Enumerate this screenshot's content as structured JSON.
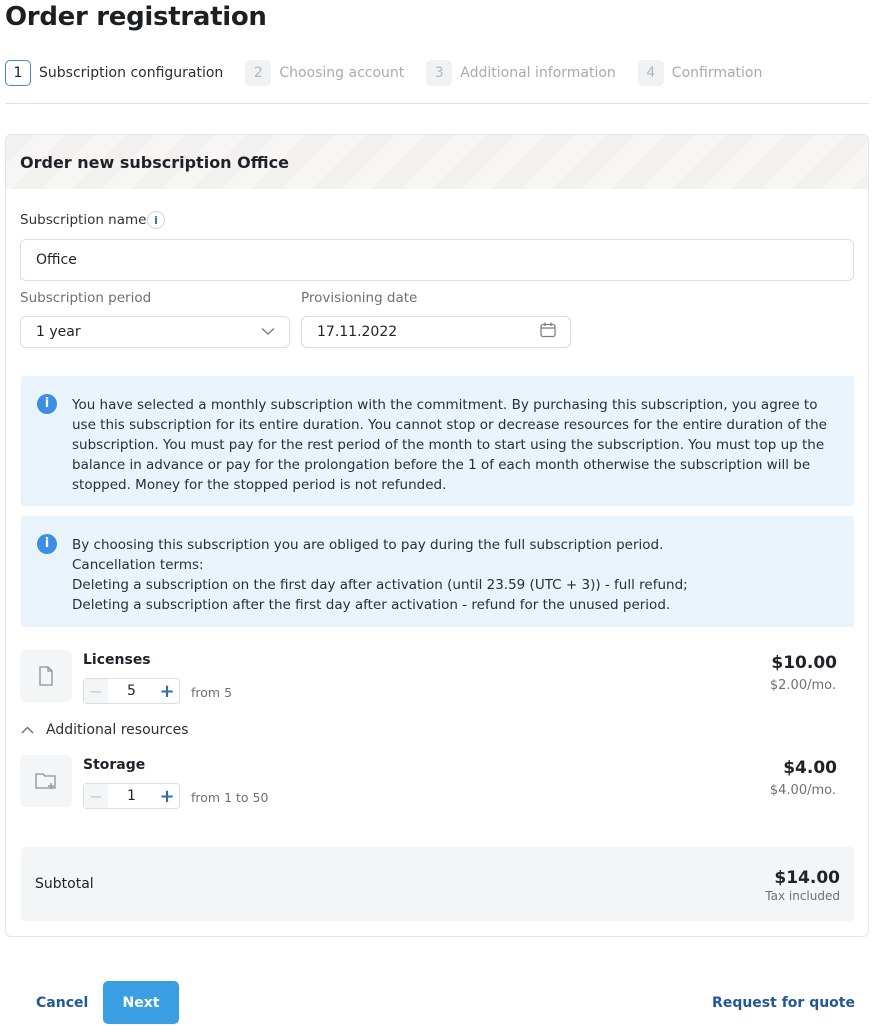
{
  "page": {
    "title": "Order registration"
  },
  "steps": [
    {
      "num": "1",
      "label": "Subscription configuration",
      "active": true
    },
    {
      "num": "2",
      "label": "Choosing account",
      "active": false
    },
    {
      "num": "3",
      "label": "Additional information",
      "active": false
    },
    {
      "num": "4",
      "label": "Confirmation",
      "active": false
    }
  ],
  "card": {
    "title": "Order new subscription Office"
  },
  "form": {
    "name_label": "Subscription name",
    "name_info_icon": "i",
    "name_value": "Office",
    "period_label": "Subscription period",
    "period_value": "1 year",
    "date_label": "Provisioning date",
    "date_value": "17.11.2022"
  },
  "alerts": [
    {
      "icon": "i",
      "text": "You have selected a monthly subscription with the commitment. By purchasing this subscription, you agree to use this subscription for its entire duration. You cannot stop or decrease resources for the entire duration of the subscription. You must pay for the rest period of the month to start using the subscription. You must top up the balance in advance or pay for the prolongation before the 1 of each month otherwise the subscription will be stopped. Money for the stopped period is not refunded."
    },
    {
      "icon": "i",
      "lines": [
        "By choosing this subscription you are obliged to pay during the full subscription period.",
        "Cancellation terms:",
        "Deleting a subscription on the first day after activation (until 23.59 (UTC + 3)) - full refund;",
        "Deleting a subscription after the first day after activation - refund for the unused period."
      ]
    }
  ],
  "resources": {
    "licenses": {
      "name": "Licenses",
      "quantity": "5",
      "range": "from 5",
      "price": "$10.00",
      "per_month": "$2.00/mo."
    },
    "additional_label": "Additional resources",
    "storage": {
      "name": "Storage",
      "quantity": "1",
      "range": "from 1  to 50",
      "price": "$4.00",
      "per_month": "$4.00/mo."
    }
  },
  "subtotal": {
    "label": "Subtotal",
    "amount": "$14.00",
    "tax_note": "Tax included"
  },
  "actions": {
    "cancel": "Cancel",
    "next": "Next",
    "quote": "Request for quote"
  },
  "icons": {
    "info": "info-icon",
    "chevron": "chevron-down-icon",
    "calendar": "calendar-icon",
    "document": "document-icon",
    "folder": "folder-add-icon",
    "collapse": "chevron-up-icon"
  },
  "colors": {
    "accent": "#3a9ee3",
    "link": "#22589a",
    "alert_bg": "#e8f3fc",
    "info_icon": "#3a8fe3"
  }
}
